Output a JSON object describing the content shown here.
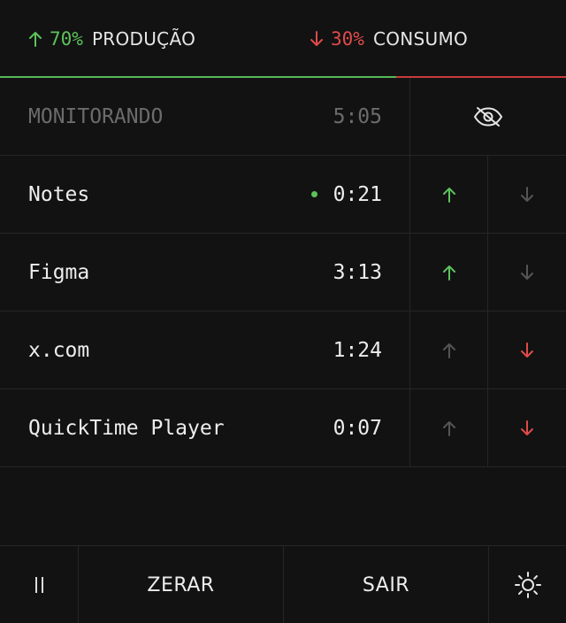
{
  "header": {
    "production": {
      "percent": "70%",
      "label": "PRODUÇÃO",
      "icon": "arrow-up-icon",
      "color": "#5cc25c",
      "share": 0.7
    },
    "consumption": {
      "percent": "30%",
      "label": "CONSUMO",
      "icon": "arrow-down-icon",
      "color": "#e04a4a",
      "share": 0.3
    }
  },
  "monitor": {
    "label": "MONITORANDO",
    "time": "5:05",
    "icon": "eye-off-icon"
  },
  "apps": [
    {
      "name": "Notes",
      "time": "0:21",
      "active": true,
      "rating": "production"
    },
    {
      "name": "Figma",
      "time": "3:13",
      "active": false,
      "rating": "production"
    },
    {
      "name": "x.com",
      "time": "1:24",
      "active": false,
      "rating": "consumption"
    },
    {
      "name": "QuickTime Player",
      "time": "0:07",
      "active": false,
      "rating": "consumption"
    }
  ],
  "footer": {
    "pause_icon": "pause-icon",
    "reset_label": "ZERAR",
    "quit_label": "SAIR",
    "theme_icon": "sun-icon"
  },
  "colors": {
    "background": "#121212",
    "production": "#5cc25c",
    "consumption": "#e04a4a",
    "inactive_arrow": "#555555",
    "border": "#262626"
  }
}
